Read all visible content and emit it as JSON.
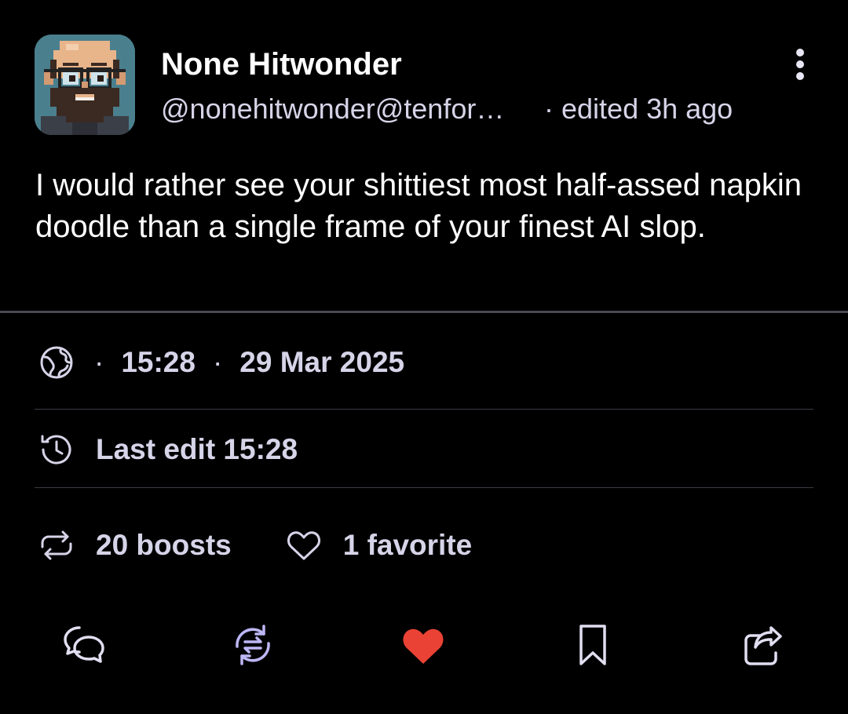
{
  "post": {
    "author": {
      "display_name": "None Hitwonder",
      "handle": "@nonehitwonder@tenforward.social",
      "avatar_icon": "pixel-art-bearded-man-avatar"
    },
    "edited_label": "edited 3h ago",
    "edited_separator": "·",
    "body": "I would rather see your shittiest most half-assed napkin doodle than a single frame of your finest AI slop.",
    "meta": {
      "visibility_icon": "globe-icon",
      "separator": "·",
      "time": "15:28",
      "date": "29 Mar 2025"
    },
    "last_edit": {
      "icon": "history-clock-icon",
      "label": "Last edit 15:28"
    },
    "stats": {
      "boosts_label": "20 boosts",
      "favorites_label": "1 favorite"
    }
  },
  "actions": [
    {
      "name": "reply",
      "icon": "chat-bubbles-icon"
    },
    {
      "name": "boost",
      "icon": "boost-arrows-icon",
      "active": true
    },
    {
      "name": "favorite",
      "icon": "heart-icon",
      "active": true
    },
    {
      "name": "bookmark",
      "icon": "bookmark-icon"
    },
    {
      "name": "share",
      "icon": "share-icon"
    }
  ],
  "colors": {
    "background": "#000000",
    "text_primary": "#ffffff",
    "text_secondary": "#d6d4e8",
    "boost_active": "#bdb7f5",
    "favorite_active": "#ea4234",
    "icon_default": "#e0def0"
  }
}
